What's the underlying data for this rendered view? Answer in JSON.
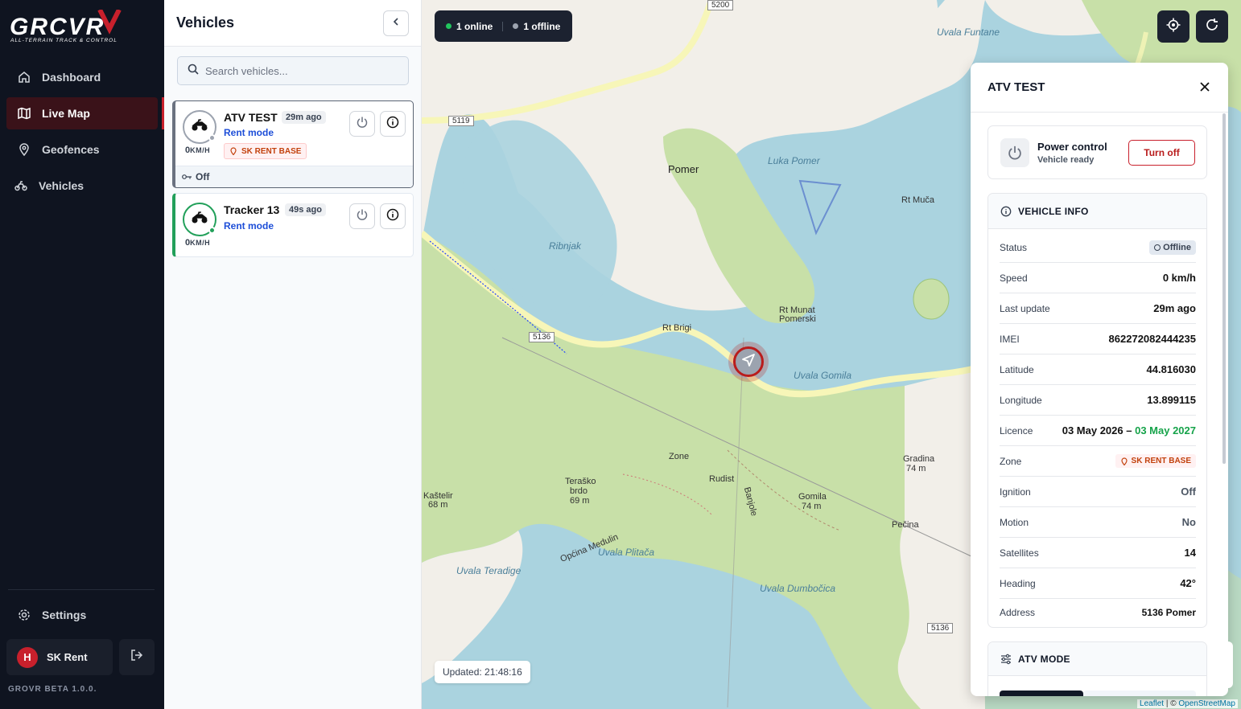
{
  "app": {
    "brand": "GRCVR",
    "brand_tagline": "ALL-TERRAIN TRACK & CONTROL",
    "version": "GROVR BETA 1.0.0."
  },
  "nav": [
    {
      "label": "Dashboard",
      "icon": "home-icon"
    },
    {
      "label": "Live Map",
      "icon": "map-icon",
      "active": true
    },
    {
      "label": "Geofences",
      "icon": "location-pin-icon"
    },
    {
      "label": "Vehicles",
      "icon": "atv-icon"
    }
  ],
  "settings_label": "Settings",
  "user": {
    "initial": "H",
    "name": "SK Rent"
  },
  "vehicles_panel": {
    "title": "Vehicles",
    "search_placeholder": "Search vehicles...",
    "items": [
      {
        "name": "ATV TEST",
        "ago": "29m ago",
        "mode": "Rent mode",
        "speed": "0",
        "speed_unit": "KM/H",
        "zone": "SK RENT BASE",
        "ignition": "Off",
        "online": false
      },
      {
        "name": "Tracker 13",
        "ago": "49s ago",
        "mode": "Rent mode",
        "speed": "0",
        "speed_unit": "KM/H",
        "online": true
      }
    ]
  },
  "map": {
    "online_count": "1 online",
    "offline_count": "1 offline",
    "updated": "Updated: 21:48:16",
    "attribution_leaflet": "Leaflet",
    "attribution_sep": " | © ",
    "attribution_osm": "OpenStreetMap",
    "colors": {
      "water": "#aad3df",
      "land": "#f2efe9",
      "forest": "#c8e0a8",
      "road": "#f7f6b8"
    },
    "labels": {
      "pomer": "Pomer",
      "luka_pomer": "Luka Pomer",
      "ribnjak": "Ribnjak",
      "rt_muca": "Rt Muča",
      "rt_brigi": "Rt Brigi",
      "rt_munat": "Rt Munat",
      "pomerski": "Pomerski",
      "uvala_gomila": "Uvala Gomila",
      "uvala_funtane": "Uvala Funtane",
      "zone": "Zone",
      "pomer2": "Pomer",
      "rudist": "Rudist",
      "terasko": "Teraško",
      "brdo": "brdo",
      "brdo_h": "69 m",
      "kastelir": "Kaštelir",
      "kastelir_h": "68 m",
      "gomila": "Gomila",
      "gomila_h": "74 m",
      "gradina": "Gradina",
      "gradina_h": "74 m",
      "pecina": "Pečina",
      "uvala_plitaca": "Uvala Plitača",
      "uvala_teradige": "Uvala Teradige",
      "uvala_dumbocica": "Uvala Dumbočica",
      "opcina_medulin": "Općina Medulin",
      "banjole": "Banjole",
      "r5200": "5200",
      "r5119": "5119",
      "r5136": "5136",
      "r5136b": "5136"
    }
  },
  "details": {
    "title": "ATV TEST",
    "power": {
      "title": "Power control",
      "subtitle": "Vehicle ready",
      "button": "Turn off"
    },
    "info_title": "VEHICLE INFO",
    "rows": {
      "status": {
        "k": "Status",
        "v": "Offline"
      },
      "speed": {
        "k": "Speed",
        "v": "0 km/h"
      },
      "last_update": {
        "k": "Last update",
        "v": "29m ago"
      },
      "imei": {
        "k": "IMEI",
        "v": "862272082444235"
      },
      "latitude": {
        "k": "Latitude",
        "v": "44.816030"
      },
      "longitude": {
        "k": "Longitude",
        "v": "13.899115"
      },
      "licence": {
        "k": "Licence",
        "from": "03 May 2026 –",
        "to": "03 May 2027"
      },
      "zone": {
        "k": "Zone",
        "v": "SK RENT BASE"
      },
      "ignition": {
        "k": "Ignition",
        "v": "Off"
      },
      "motion": {
        "k": "Motion",
        "v": "No"
      },
      "satellites": {
        "k": "Satellites",
        "v": "14"
      },
      "heading": {
        "k": "Heading",
        "v": "42°"
      },
      "address": {
        "k": "Address",
        "v": "5136 Pomer"
      }
    },
    "atv_mode_title": "ATV MODE"
  }
}
